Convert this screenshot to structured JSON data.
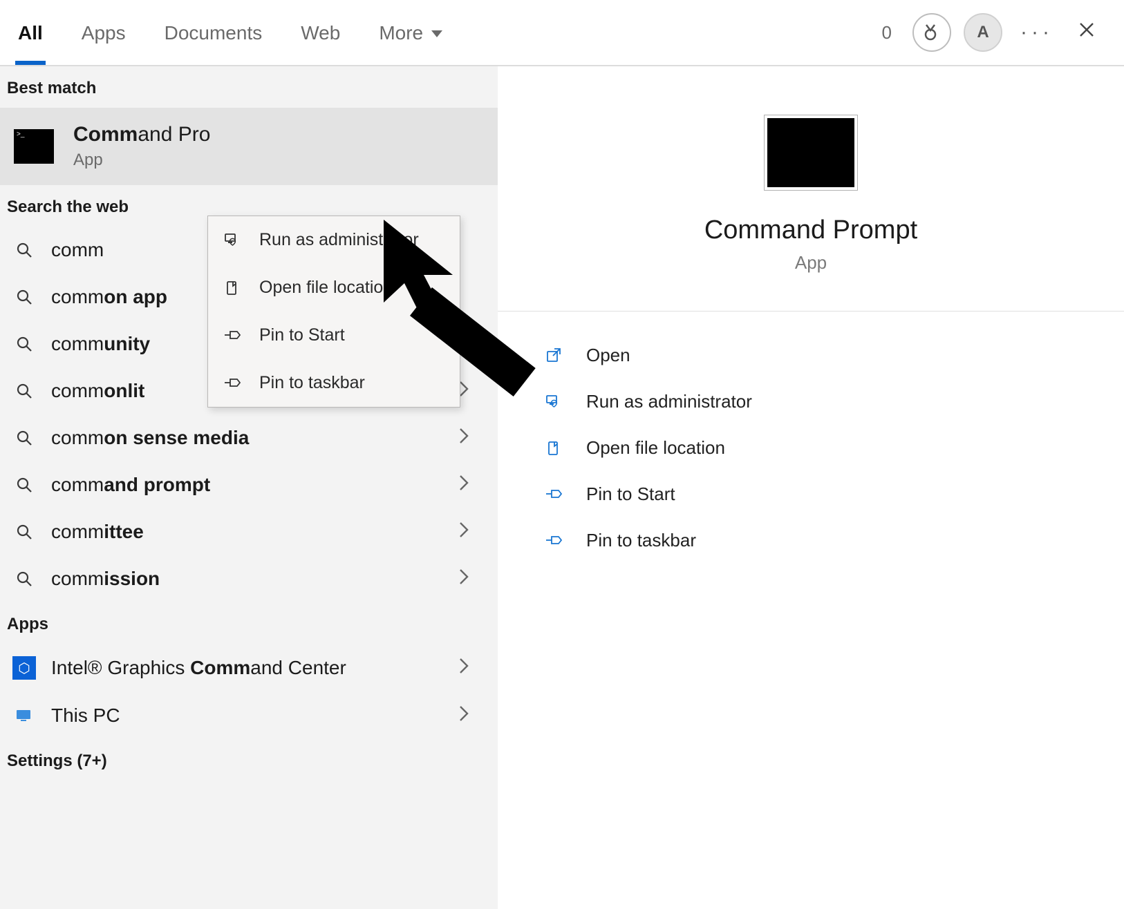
{
  "topbar": {
    "tabs": [
      "All",
      "Apps",
      "Documents",
      "Web",
      "More"
    ],
    "active_index": 0,
    "reward_count": "0",
    "avatar_initial": "A"
  },
  "sections": {
    "best_match": "Best match",
    "search_web": "Search the web",
    "apps": "Apps",
    "settings": "Settings (7+)"
  },
  "best_match": {
    "title_prefix": "Comm",
    "title_suffix": "and Pro",
    "subtitle": "App"
  },
  "web_suggestions": [
    {
      "prefix": "comm",
      "bold": "",
      "arrow": false
    },
    {
      "prefix": "comm",
      "bold": "on app",
      "arrow": false
    },
    {
      "prefix": "comm",
      "bold": "unity",
      "arrow": true
    },
    {
      "prefix": "comm",
      "bold": "onlit",
      "arrow": true
    },
    {
      "prefix": "comm",
      "bold": "on sense media",
      "arrow": true
    },
    {
      "prefix": "comm",
      "bold": "and prompt",
      "arrow": true
    },
    {
      "prefix": "comm",
      "bold": "ittee",
      "arrow": true
    },
    {
      "prefix": "comm",
      "bold": "ission",
      "arrow": true
    }
  ],
  "app_results": [
    {
      "pre": "Intel® Graphics ",
      "bold": "Comm",
      "post": "and Center",
      "icon": "intel"
    },
    {
      "pre": "This PC",
      "bold": "",
      "post": "",
      "icon": "pc"
    }
  ],
  "context_menu": [
    {
      "icon": "admin",
      "label": "Run as administrator"
    },
    {
      "icon": "folder",
      "label": "Open file location"
    },
    {
      "icon": "pin",
      "label": "Pin to Start"
    },
    {
      "icon": "pin",
      "label": "Pin to taskbar"
    }
  ],
  "preview": {
    "title": "Command Prompt",
    "subtitle": "App",
    "actions": [
      {
        "icon": "open",
        "label": "Open"
      },
      {
        "icon": "admin",
        "label": "Run as administrator"
      },
      {
        "icon": "folder",
        "label": "Open file location"
      },
      {
        "icon": "pin",
        "label": "Pin to Start"
      },
      {
        "icon": "pin",
        "label": "Pin to taskbar"
      }
    ]
  }
}
